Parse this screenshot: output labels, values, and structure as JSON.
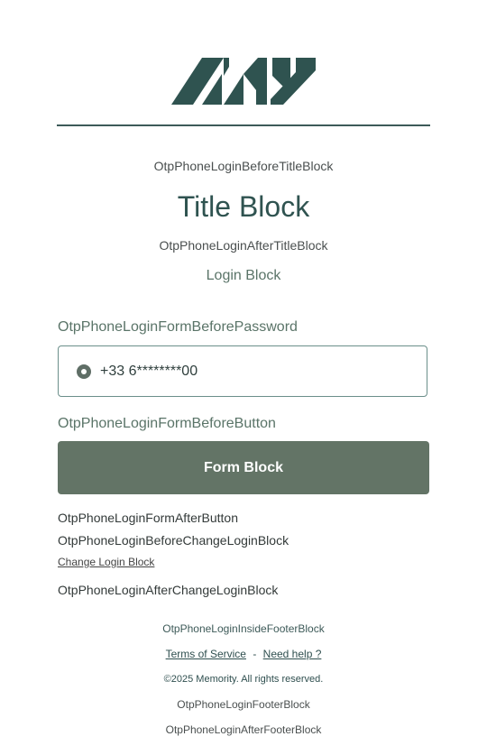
{
  "header": {
    "logo_name": "my-logo",
    "brand_color": "#2f5350"
  },
  "blocks": {
    "before_title": "OtpPhoneLoginBeforeTitleBlock",
    "title": "Title Block",
    "after_title": "OtpPhoneLoginAfterTitleBlock",
    "login_block": "Login Block"
  },
  "form": {
    "before_password": "OtpPhoneLoginFormBeforePassword",
    "phone_value": "+33 6********00",
    "before_button": "OtpPhoneLoginFormBeforeButton",
    "button_label": "Form Block",
    "after_button": "OtpPhoneLoginFormAfterButton",
    "button_color": "#637466"
  },
  "change_login": {
    "before": "OtpPhoneLoginBeforeChangeLoginBlock",
    "link_label": "Change Login Block",
    "after": "OtpPhoneLoginAfterChangeLoginBlock"
  },
  "footer": {
    "inside": "OtpPhoneLoginInsideFooterBlock",
    "terms_label": "Terms of Service",
    "separator": "-",
    "help_label": "Need help ?",
    "copyright": "©2025 Memority. All rights reserved.",
    "footer_block": "OtpPhoneLoginFooterBlock",
    "after_footer": "OtpPhoneLoginAfterFooterBlock"
  }
}
